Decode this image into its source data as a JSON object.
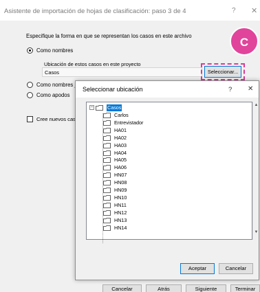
{
  "outer": {
    "title": "Asistente de importación de hojas de clasificación: paso 3 de 4",
    "help": "?",
    "close": "✕",
    "instruction": "Especifique la forma en que se representan los casos en este archivo",
    "radio_nombres": "Como nombres",
    "location_label": "Ubicación de estos casos en este proyecto",
    "location_value": "Casos",
    "select_button": "Seleccionar...",
    "radio_nombres_jer": "Como nombres je",
    "radio_apodos": "Como apodos",
    "checkbox_crear": "Cree nuevos cas",
    "badge": "C",
    "footer": {
      "cancel": "Cancelar",
      "back": "Atrás",
      "next": "Siguiente",
      "finish": "Terminar"
    }
  },
  "inner": {
    "title": "Seleccionar ubicación",
    "help": "?",
    "close": "✕",
    "tree_root": "Casos",
    "tree_children": [
      "Carlos",
      "Entrevistador",
      "HA01",
      "HA02",
      "HA03",
      "HA04",
      "HA05",
      "HA06",
      "HN07",
      "HN08",
      "HN09",
      "HN10",
      "HN11",
      "HN12",
      "HN13",
      "HN14"
    ],
    "accept": "Aceptar",
    "cancel": "Cancelar"
  },
  "colors": {
    "accent": "#0078d7",
    "badge": "#e1449b"
  }
}
